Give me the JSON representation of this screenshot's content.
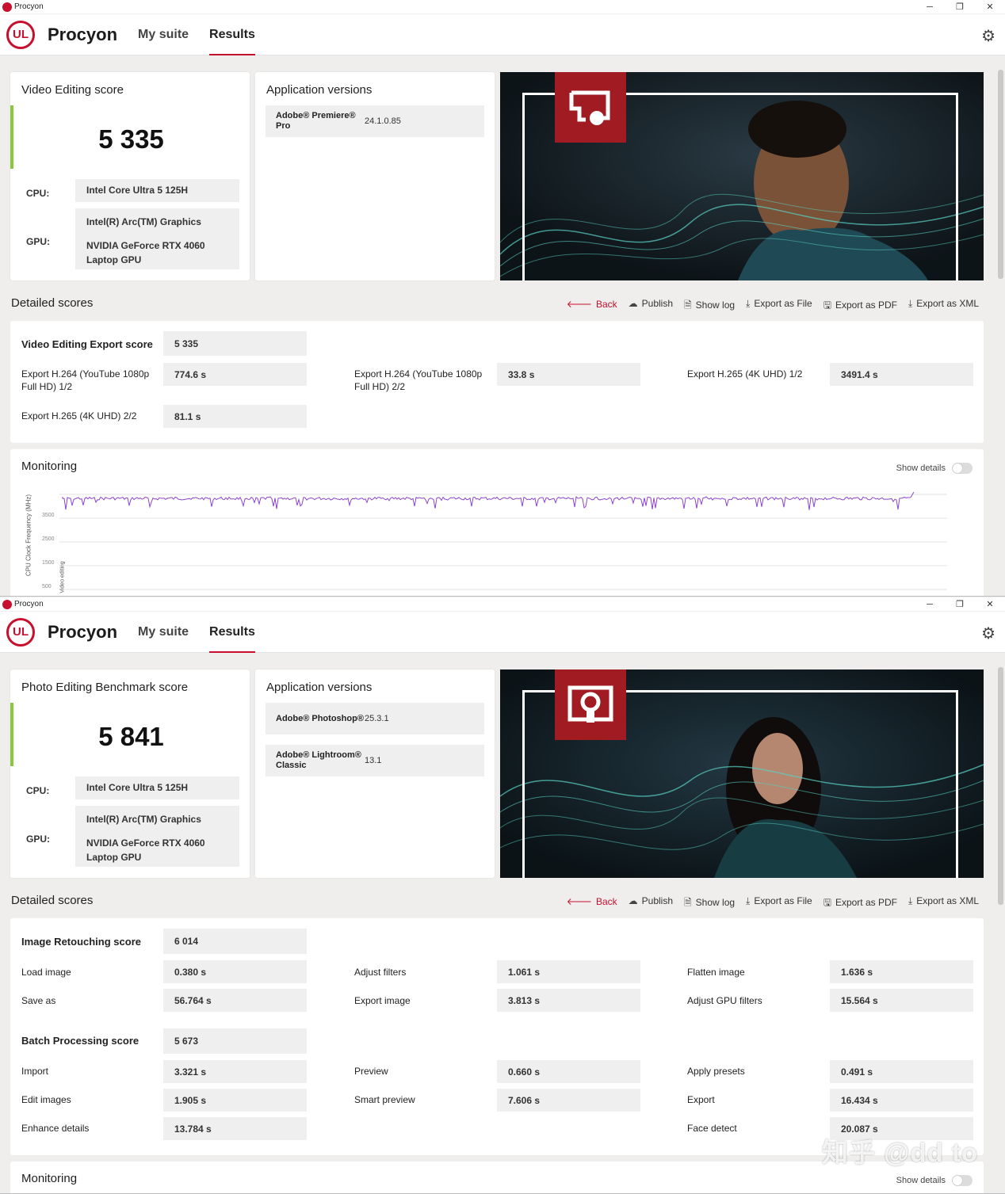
{
  "app_title": "Procyon",
  "window_controls": {
    "minimize": "─",
    "maximize": "❐",
    "close": "✕"
  },
  "brand": {
    "logo": "UL",
    "name": "Procyon"
  },
  "nav": {
    "my_suite": "My suite",
    "results": "Results"
  },
  "actions": {
    "back": "Back",
    "publish": "Publish",
    "show_log": "Show log",
    "export_file": "Export as File",
    "export_pdf": "Export as PDF",
    "export_xml": "Export as XML"
  },
  "detailed_scores_title": "Detailed scores",
  "monitoring_title": "Monitoring",
  "show_details": "Show details",
  "video": {
    "score_title": "Video Editing score",
    "score": "5 335",
    "cpu_label": "CPU:",
    "cpu": "Intel Core Ultra 5 125H",
    "gpu_label": "GPU:",
    "gpu1": "Intel(R) Arc(TM) Graphics",
    "gpu2": "NVIDIA GeForce RTX 4060 Laptop GPU",
    "app_versions_title": "Application versions",
    "apps": [
      {
        "name": "Adobe® Premiere® Pro",
        "version": "24.1.0.85"
      }
    ],
    "export_score_label": "Video Editing Export score",
    "export_score": "5 335",
    "tests": [
      {
        "name": "Export H.264 (YouTube 1080p Full HD) 1/2",
        "value": "774.6 s"
      },
      {
        "name": "Export H.264 (YouTube 1080p Full HD) 2/2",
        "value": "33.8 s"
      },
      {
        "name": "Export H.265 (4K UHD) 1/2",
        "value": "3491.4 s"
      },
      {
        "name": "Export H.265 (4K UHD) 2/2",
        "value": "81.1 s"
      }
    ],
    "monitor": {
      "ylabel": "CPU Clock Frequency (MHz)",
      "yticks": [
        "3500",
        "2500",
        "1500",
        "500"
      ],
      "phase_label": "Video editing",
      "series_color": "#8e44c8"
    }
  },
  "photo": {
    "score_title": "Photo Editing Benchmark score",
    "score": "5 841",
    "cpu_label": "CPU:",
    "cpu": "Intel Core Ultra 5 125H",
    "gpu_label": "GPU:",
    "gpu1": "Intel(R) Arc(TM) Graphics",
    "gpu2": "NVIDIA GeForce RTX 4060 Laptop GPU",
    "app_versions_title": "Application versions",
    "apps": [
      {
        "name": "Adobe® Photoshop®",
        "version": "25.3.1"
      },
      {
        "name": "Adobe® Lightroom® Classic",
        "version": "13.1"
      }
    ],
    "retouch_label": "Image Retouching score",
    "retouch_score": "6 014",
    "retouch_tests": [
      {
        "name": "Load image",
        "value": "0.380 s"
      },
      {
        "name": "Adjust filters",
        "value": "1.061 s"
      },
      {
        "name": "Flatten image",
        "value": "1.636 s"
      },
      {
        "name": "Save as",
        "value": "56.764 s"
      },
      {
        "name": "Export image",
        "value": "3.813 s"
      },
      {
        "name": "Adjust GPU filters",
        "value": "15.564 s"
      }
    ],
    "batch_label": "Batch Processing score",
    "batch_score": "5 673",
    "batch_tests": [
      {
        "name": "Import",
        "value": "3.321 s"
      },
      {
        "name": "Preview",
        "value": "0.660 s"
      },
      {
        "name": "Apply presets",
        "value": "0.491 s"
      },
      {
        "name": "Edit images",
        "value": "1.905 s"
      },
      {
        "name": "Smart preview",
        "value": "7.606 s"
      },
      {
        "name": "Export",
        "value": "16.434 s"
      },
      {
        "name": "Enhance details",
        "value": "13.784 s"
      },
      {
        "name": "Face detect",
        "value": "20.087 s"
      }
    ]
  },
  "watermark": "知乎 @dd to",
  "colors": {
    "brand_red": "#c8102e",
    "score_accent": "#8cc63f",
    "badge_red": "#a01b22"
  }
}
